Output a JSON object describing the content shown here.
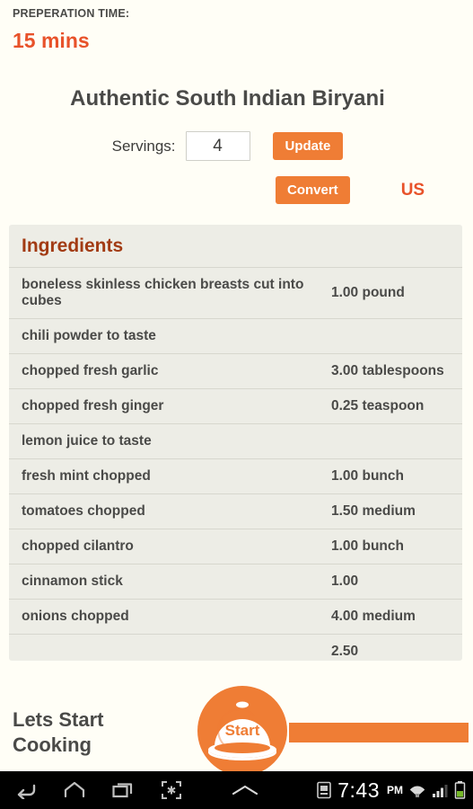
{
  "header": {
    "prep_time_label": "PREPERATION TIME:",
    "prep_time_value": "15 mins"
  },
  "recipe": {
    "title": "Authentic South Indian Biryani"
  },
  "servings": {
    "label": "Servings:",
    "value": "4",
    "placeholder": "4",
    "update_label": "Update"
  },
  "convert": {
    "button_label": "Convert",
    "unit_system": "US"
  },
  "ingredients": {
    "header": "Ingredients",
    "items": [
      {
        "name": "boneless skinless chicken breasts cut into cubes",
        "qty": "1.00 pound"
      },
      {
        "name": "chili powder to taste",
        "qty": ""
      },
      {
        "name": "chopped fresh garlic",
        "qty": "3.00 tablespoons"
      },
      {
        "name": "chopped fresh ginger",
        "qty": "0.25 teaspoon"
      },
      {
        "name": "lemon juice to taste",
        "qty": ""
      },
      {
        "name": "fresh mint chopped",
        "qty": "1.00 bunch"
      },
      {
        "name": "tomatoes chopped",
        "qty": "1.50 medium"
      },
      {
        "name": "chopped cilantro",
        "qty": "1.00 bunch"
      },
      {
        "name": "cinnamon stick",
        "qty": "1.00"
      },
      {
        "name": "onions chopped",
        "qty": "4.00 medium"
      },
      {
        "name": "",
        "qty": "2.50"
      }
    ]
  },
  "start": {
    "label": "Lets Start Cooking",
    "button_label": "Start"
  },
  "statusbar": {
    "time": "7:43",
    "ampm": "PM"
  },
  "colors": {
    "page_background": "#FFFEF6",
    "panel_background": "#EDEDE6",
    "accent_orange": "#EF7D35",
    "accent_red": "#E8522A",
    "header_brown": "#A23B13",
    "text_dark": "#4A4A48"
  }
}
